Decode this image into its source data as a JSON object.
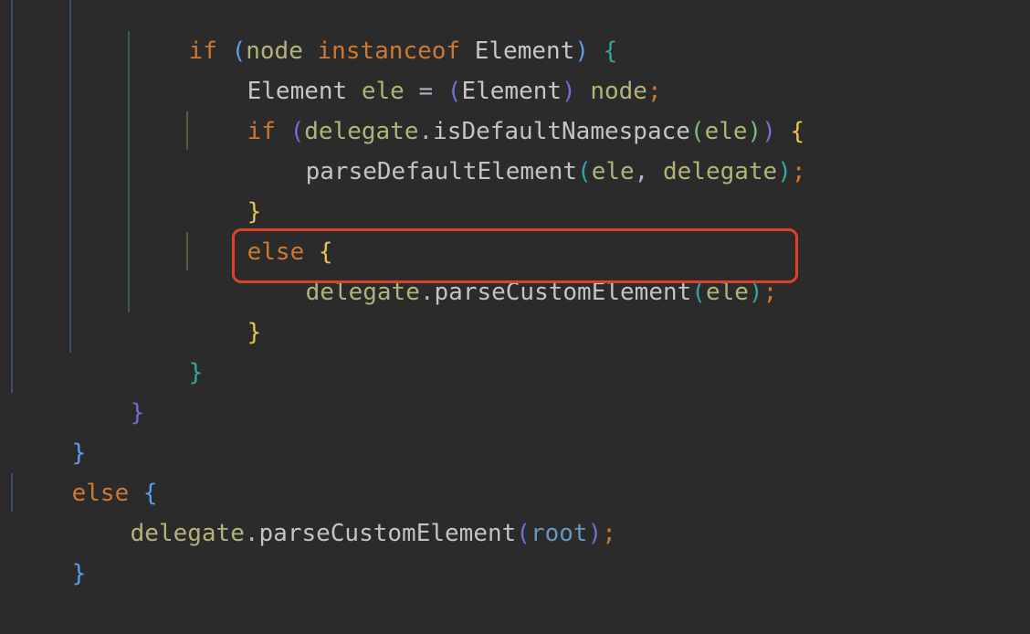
{
  "code": {
    "lines": [
      {
        "tokens": [
          "if",
          " ",
          "(",
          "node",
          " ",
          "instanceof",
          " ",
          "Element",
          ")",
          " ",
          "{"
        ]
      },
      {
        "tokens": [
          "Element",
          " ",
          "ele",
          " = ",
          "(",
          "Element",
          ")",
          " ",
          "node",
          ";"
        ]
      },
      {
        "tokens": [
          "if",
          " ",
          "(",
          "delegate",
          ".",
          "isDefaultNamespace",
          "(",
          "ele",
          ")",
          ")",
          " ",
          "{"
        ]
      },
      {
        "tokens": [
          "parseDefaultElement",
          "(",
          "ele",
          ", ",
          "delegate",
          ")",
          ";"
        ]
      },
      {
        "tokens": [
          "}"
        ]
      },
      {
        "tokens": [
          "else",
          " ",
          "{"
        ]
      },
      {
        "tokens": [
          "delegate",
          ".",
          "parseCustomElement",
          "(",
          "ele",
          ")",
          ";"
        ]
      },
      {
        "tokens": [
          "}"
        ]
      },
      {
        "tokens": [
          "}"
        ]
      },
      {
        "tokens": [
          "}"
        ]
      },
      {
        "tokens": [
          "}"
        ]
      },
      {
        "tokens": [
          "else",
          " ",
          "{"
        ]
      },
      {
        "tokens": [
          "delegate",
          ".",
          "parseCustomElement",
          "(",
          "root",
          ")",
          ";"
        ]
      },
      {
        "tokens": [
          "}"
        ]
      }
    ]
  },
  "colors": {
    "background": "#2b2b2b",
    "keyword": "#cc7832",
    "highlight_border": "#e0402a"
  }
}
